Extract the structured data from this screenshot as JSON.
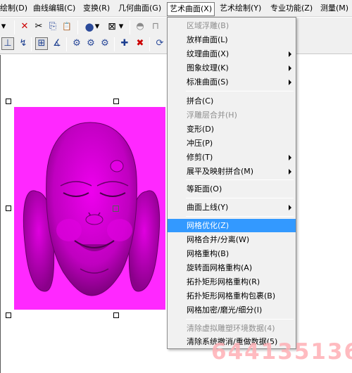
{
  "menubar": {
    "items": [
      {
        "label": "绘制(D)"
      },
      {
        "label": "曲线编辑(C)"
      },
      {
        "label": "变换(R)"
      },
      {
        "label": "几何曲面(G)"
      },
      {
        "label": "艺术曲面(X)"
      },
      {
        "label": "艺术绘制(Y)"
      },
      {
        "label": "专业功能(Z)"
      },
      {
        "label": "测量(M)"
      }
    ]
  },
  "toolbar": {
    "row1": [
      {
        "icon": "dropdown-arrow-icon",
        "glyph": "▾"
      },
      {
        "icon": "delete-icon",
        "glyph": "✕",
        "color": "#cc0000"
      },
      {
        "icon": "cut-icon",
        "glyph": "✂"
      },
      {
        "icon": "copy-icon",
        "glyph": "⎘"
      },
      {
        "icon": "paste-icon",
        "glyph": "📋"
      },
      {
        "icon": "shading-sphere-icon",
        "glyph": "●",
        "color": "#2b4a9a"
      },
      {
        "icon": "dropdown-arrow-icon",
        "glyph": "▾"
      },
      {
        "icon": "wireframe-box-icon",
        "glyph": "⊠"
      },
      {
        "icon": "dropdown-arrow-icon",
        "glyph": "▾"
      },
      {
        "icon": "dome-icon",
        "glyph": "◓",
        "color": "#8a8a8a"
      },
      {
        "icon": "cylinder-icon",
        "glyph": "⊓",
        "color": "#8a8a8a"
      }
    ],
    "row2": [
      {
        "icon": "axis-icon",
        "glyph": "⊥"
      },
      {
        "icon": "curve-snap-icon",
        "glyph": "↯"
      },
      {
        "icon": "grid-snap-icon",
        "glyph": "⊞"
      },
      {
        "icon": "angle-snap-icon",
        "glyph": "∡"
      },
      {
        "icon": "view-front-icon",
        "glyph": "⚙"
      },
      {
        "icon": "view-side-icon",
        "glyph": "⚙"
      },
      {
        "icon": "view-top-icon",
        "glyph": "⚙"
      },
      {
        "icon": "add-point-icon",
        "glyph": "✚"
      },
      {
        "icon": "remove-point-icon",
        "glyph": "✖"
      },
      {
        "icon": "rotate-view-icon",
        "glyph": "⟳"
      }
    ]
  },
  "dropdown": {
    "items": [
      {
        "label": "区域浮雕(B)",
        "disabled": true
      },
      {
        "label": "放样曲面(L)"
      },
      {
        "label": "纹理曲面(X)",
        "submenu": true
      },
      {
        "label": "图象纹理(K)",
        "submenu": true
      },
      {
        "label": "标准曲面(S)",
        "submenu": true
      },
      {
        "label": "拼合(C)"
      },
      {
        "label": "浮雕层合并(H)",
        "disabled": true
      },
      {
        "label": "变形(D)"
      },
      {
        "label": "冲压(P)"
      },
      {
        "label": "修剪(T)",
        "submenu": true
      },
      {
        "label": "展平及映射拼合(M)",
        "submenu": true
      },
      {
        "label": "等距面(O)"
      },
      {
        "label": "曲面上线(Y)",
        "submenu": true
      },
      {
        "label": "网格优化(Z)",
        "highlighted": true
      },
      {
        "label": "网格合并/分离(W)"
      },
      {
        "label": "网格重构(B)"
      },
      {
        "label": "旋转面网格重构(A)"
      },
      {
        "label": "拓扑矩形网格重构(R)"
      },
      {
        "label": "拓扑矩形网格重构包裹(B)"
      },
      {
        "label": "网格加密/磨光/细分(I)"
      },
      {
        "label": "清除虚拟雕塑环境数据(4)",
        "disabled": true
      },
      {
        "label": "清除系统撤消/重做数据(5)"
      }
    ]
  },
  "canvas": {
    "relief_color": "#ff28ff"
  },
  "watermark": {
    "text": "644135136"
  }
}
